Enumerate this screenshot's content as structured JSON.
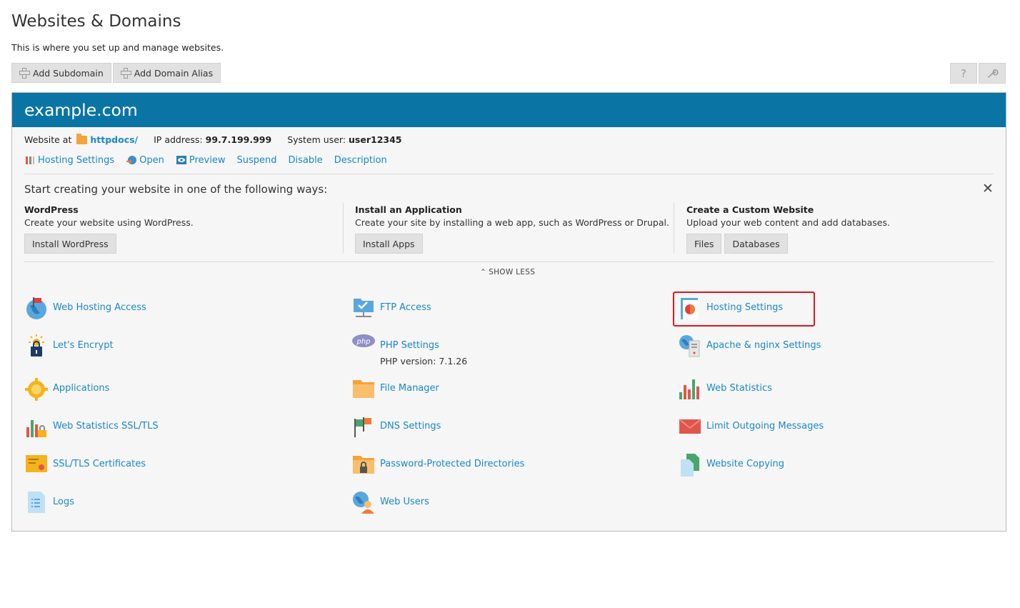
{
  "page": {
    "title": "Websites & Domains",
    "description": "This is where you set up and manage websites."
  },
  "toolbar": {
    "add_subdomain": "Add Subdomain",
    "add_domain_alias": "Add Domain Alias",
    "help_icon": "?",
    "tools_icon": "wrench-icon"
  },
  "domain": {
    "name": "example.com",
    "website_at_label": "Website at",
    "docroot": "httpdocs/",
    "ip_label": "IP address:",
    "ip": "99.7.199.999",
    "user_label": "System user:",
    "user": "user12345",
    "actions": [
      "Hosting Settings",
      "Open",
      "Preview",
      "Suspend",
      "Disable",
      "Description"
    ]
  },
  "start": {
    "title": "Start creating your website in one of the following ways:",
    "close": "✕",
    "columns": [
      {
        "heading": "WordPress",
        "text": "Create your website using WordPress.",
        "buttons": [
          "Install WordPress"
        ]
      },
      {
        "heading": "Install an Application",
        "text": "Create your site by installing a web app, such as WordPress or Drupal.",
        "buttons": [
          "Install Apps"
        ]
      },
      {
        "heading": "Create a Custom Website",
        "text": "Upload your web content and add databases.",
        "buttons": [
          "Files",
          "Databases"
        ]
      }
    ],
    "show_less": "SHOW LESS"
  },
  "tools": {
    "col1": [
      "Web Hosting Access",
      "Let's Encrypt",
      "Applications",
      "Web Statistics SSL/TLS",
      "SSL/TLS Certificates",
      "Logs"
    ],
    "col2": [
      "FTP Access",
      "PHP Settings",
      "File Manager",
      "DNS Settings",
      "Password-Protected Directories",
      "Web Users"
    ],
    "php_version": "PHP version: 7.1.26",
    "col3": [
      "Hosting Settings",
      "Apache & nginx Settings",
      "Web Statistics",
      "Limit Outgoing Messages",
      "Website Copying"
    ]
  },
  "colors": {
    "header_blue": "#0a75a5",
    "link_blue": "#1a88c8",
    "highlight_red": "#e0141e"
  }
}
